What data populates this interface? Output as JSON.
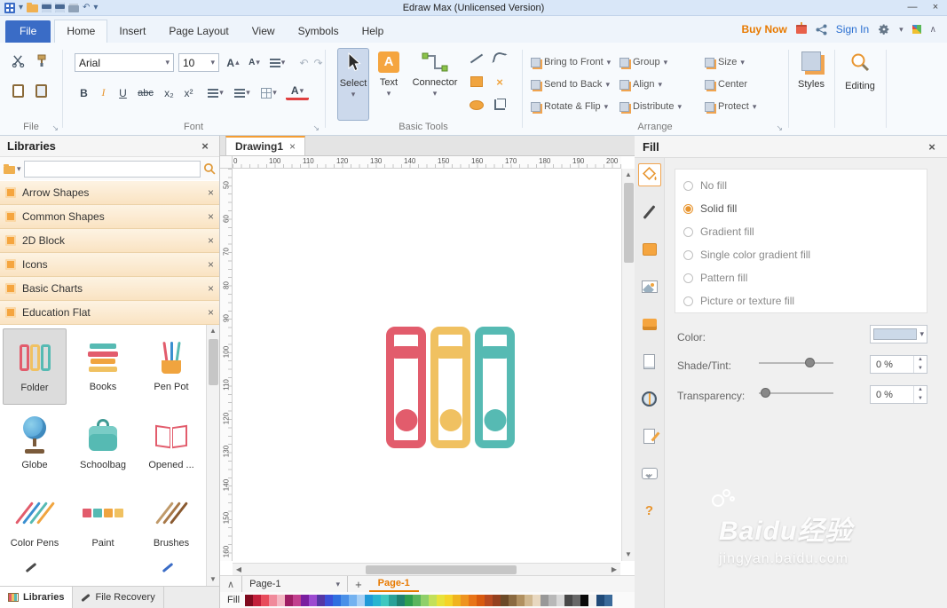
{
  "icons": {
    "close": "×",
    "caret": "▾",
    "caret_up": "▴",
    "up": "▲",
    "down": "▼",
    "left": "◀",
    "right": "▶",
    "chevron_up": "∧",
    "launcher": "↘",
    "plus": "+",
    "minus": "—",
    "undo": "↶",
    "redo": "↷",
    "letter_a": "A",
    "ellipsis": "..."
  },
  "titlebar": {
    "title": "Edraw Max (Unlicensed Version)"
  },
  "menubar": {
    "tabs": [
      "File",
      "Home",
      "Insert",
      "Page Layout",
      "View",
      "Symbols",
      "Help"
    ],
    "active": "Home",
    "buy_now": "Buy Now",
    "sign_in": "Sign In"
  },
  "ribbon": {
    "file_group": {
      "label": "File"
    },
    "font_group": {
      "label": "Font",
      "font_name": "Arial",
      "font_size": "10",
      "bold": "B",
      "italic": "I",
      "underline": "U",
      "strike": "abc",
      "subscript": "x₂",
      "superscript": "x²"
    },
    "basic_tools": {
      "label": "Basic Tools",
      "select": "Select",
      "text": "Text",
      "connector": "Connector"
    },
    "arrange": {
      "label": "Arrange",
      "buttons": [
        "Bring to Front",
        "Send to Back",
        "Rotate & Flip",
        "Group",
        "Align",
        "Distribute",
        "Size",
        "Center",
        "Protect"
      ]
    },
    "styles": "Styles",
    "editing": "Editing"
  },
  "libraries_panel": {
    "title": "Libraries",
    "groups": [
      "Arrow Shapes",
      "Common Shapes",
      "2D Block",
      "Icons",
      "Basic Charts",
      "Education Flat"
    ],
    "shapes": [
      "Folder",
      "Books",
      "Pen Pot",
      "Globe",
      "Schoolbag",
      "Opened ...",
      "Color Pens",
      "Paint",
      "Brushes"
    ],
    "selected_shape": "Folder",
    "bottom_tabs": [
      "Libraries",
      "File Recovery"
    ]
  },
  "canvas": {
    "tab": "Drawing1",
    "h_ruler": [
      "0",
      "100",
      "110",
      "120",
      "130",
      "140",
      "150",
      "160",
      "170",
      "180",
      "190",
      "200"
    ],
    "v_ruler": [
      "50",
      "60",
      "70",
      "80",
      "90",
      "100",
      "110",
      "120",
      "130",
      "140",
      "150",
      "160"
    ],
    "page_nav": "Page-1",
    "active_page": "Page-1",
    "status_label": "Fill",
    "shape_colors": [
      "#e25c6c",
      "#f0c161",
      "#56bab3"
    ]
  },
  "palette": [
    "#7f0a1e",
    "#c21f3a",
    "#e84c5c",
    "#f08a9b",
    "#f4b8c4",
    "#9e1e64",
    "#c2408e",
    "#7a1fa0",
    "#9c4ad0",
    "#5536a5",
    "#3b4fd8",
    "#2f6fe0",
    "#4a90e8",
    "#74b2f0",
    "#a8d0f5",
    "#1f9ad8",
    "#28b5d0",
    "#3fc8c0",
    "#2aa198",
    "#1f8070",
    "#2f9e4f",
    "#5ab55e",
    "#8fd06a",
    "#c2e05a",
    "#e8e23a",
    "#f5d428",
    "#f0b41f",
    "#ee9420",
    "#e87418",
    "#d85a10",
    "#b84a20",
    "#94401f",
    "#6b4a28",
    "#8a6a40",
    "#b09060",
    "#d0b890",
    "#e8d8c0",
    "#989898",
    "#b8b8b8",
    "#d8d8d8",
    "#484848",
    "#686868",
    "#0a0a0a",
    "#f0f0f0",
    "#204a78",
    "#3a6a9a"
  ],
  "fill_panel": {
    "title": "Fill",
    "options": [
      "No fill",
      "Solid fill",
      "Gradient fill",
      "Single color gradient fill",
      "Pattern fill",
      "Picture or texture fill"
    ],
    "selected_option": "Solid fill",
    "color_label": "Color:",
    "color_value": "#ccd9e8",
    "shade_label": "Shade/Tint:",
    "shade_value": "0 %",
    "shade_percent": 62,
    "transparency_label": "Transparency:",
    "transparency_value": "0 %",
    "transparency_percent": 2
  },
  "watermark": {
    "line1": "Baidu经验",
    "line2": "jingyan.baidu.com"
  }
}
